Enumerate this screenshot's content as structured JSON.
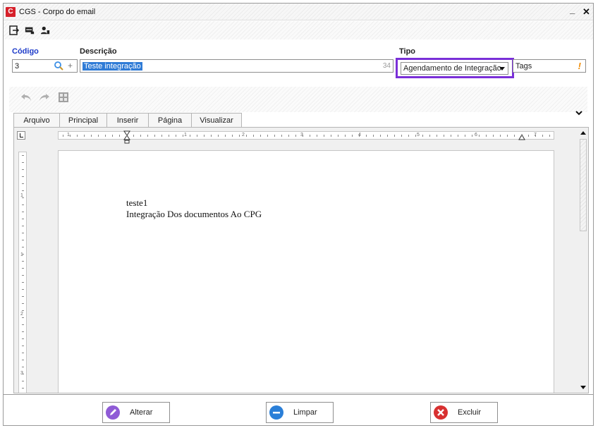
{
  "window": {
    "title": "CGS - Corpo do email",
    "minimize": "_",
    "close": "✕"
  },
  "toolbar": {
    "icons": [
      "exit-icon",
      "message-icon",
      "user-icon"
    ]
  },
  "form": {
    "codigo_label": "Código",
    "codigo_value": "3",
    "descricao_label": "Descrição",
    "descricao_value": "Teste integração",
    "descricao_count": "34",
    "tipo_label": "Tipo",
    "tipo_value": "Agendamento de Integração",
    "tags_label": "Tags",
    "tags_warning": "!"
  },
  "ribbon": {
    "tabs": [
      "Arquivo",
      "Principal",
      "Inserir",
      "Página",
      "Visualizar"
    ],
    "collapse_icon": "chevron-down-icon"
  },
  "ruler": {
    "h_numbers": [
      "1",
      "1",
      "2",
      "3",
      "4",
      "5",
      "6",
      "7"
    ],
    "v_numbers": [
      "1",
      "1",
      "2",
      "3"
    ]
  },
  "document": {
    "lines": [
      "teste1",
      "Integração Dos documentos Ao CPG"
    ]
  },
  "buttons": {
    "alterar": "Alterar",
    "limpar": "Limpar",
    "excluir": "Excluir"
  },
  "colors": {
    "title_blue": "#1d3bc9",
    "highlight_purple": "#7a2fd8",
    "selection_blue": "#2f7bd6",
    "warning_orange": "#f08a00",
    "alterar_purple": "#8f5bd6",
    "limpar_blue": "#2a7fd8",
    "excluir_red": "#d83030"
  }
}
